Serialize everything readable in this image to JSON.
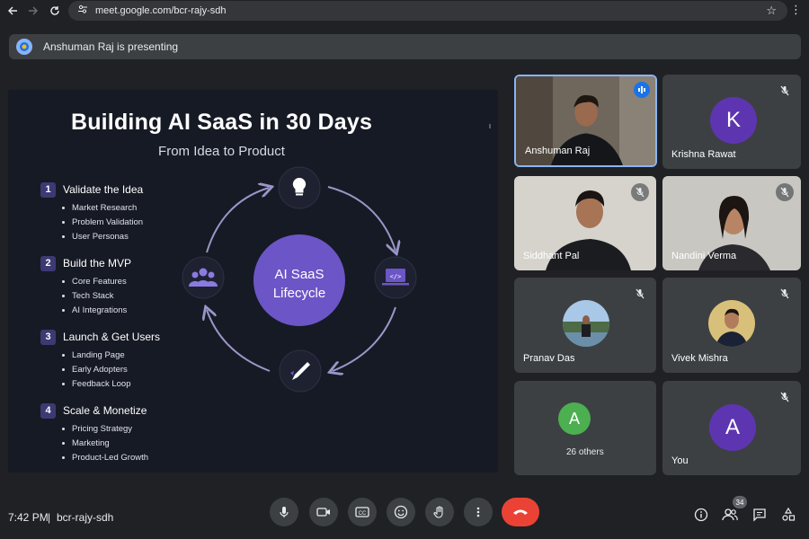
{
  "browser": {
    "url": "meet.google.com/bcr-rajy-sdh"
  },
  "banner": {
    "text": "Anshuman Raj is presenting"
  },
  "slide": {
    "title": "Building AI SaaS in 30 Days",
    "subtitle": "From Idea to Product",
    "center_line1": "AI SaaS",
    "center_line2": "Lifecycle",
    "steps": [
      {
        "num": "1",
        "title": "Validate the Idea",
        "bullets": [
          "Market Research",
          "Problem Validation",
          "User Personas"
        ]
      },
      {
        "num": "2",
        "title": "Build the MVP",
        "bullets": [
          "Core Features",
          "Tech Stack",
          "AI Integrations"
        ]
      },
      {
        "num": "3",
        "title": "Launch & Get Users",
        "bullets": [
          "Landing Page",
          "Early Adopters",
          "Feedback Loop"
        ]
      },
      {
        "num": "4",
        "title": "Scale & Monetize",
        "bullets": [
          "Pricing Strategy",
          "Marketing",
          "Product-Led Growth"
        ]
      }
    ],
    "cycle_icons": [
      "lightbulb-icon",
      "code-laptop-icon",
      "rocket-icon",
      "users-icon"
    ]
  },
  "participants": [
    {
      "name": "Anshuman Raj",
      "speaking": true
    },
    {
      "name": "Krishna Rawat",
      "initial": "K",
      "color": "#5e35b1"
    },
    {
      "name": "Siddhant Pal"
    },
    {
      "name": "Nandini Verma"
    },
    {
      "name": "Pranav Das"
    },
    {
      "name": "Vivek Mishra"
    },
    {
      "label": "26 others",
      "initial": "A",
      "color": "#4caf50"
    },
    {
      "name": "You",
      "initial": "A",
      "color": "#5e35b1"
    }
  ],
  "footer": {
    "time": "7:42 PM",
    "separator": "|",
    "meeting_code": "bcr-rajy-sdh",
    "people_count": "34"
  },
  "colors": {
    "end_call": "#ea4335",
    "slide_accent": "#6c55c7",
    "speaking_border": "#8ab4f8"
  }
}
